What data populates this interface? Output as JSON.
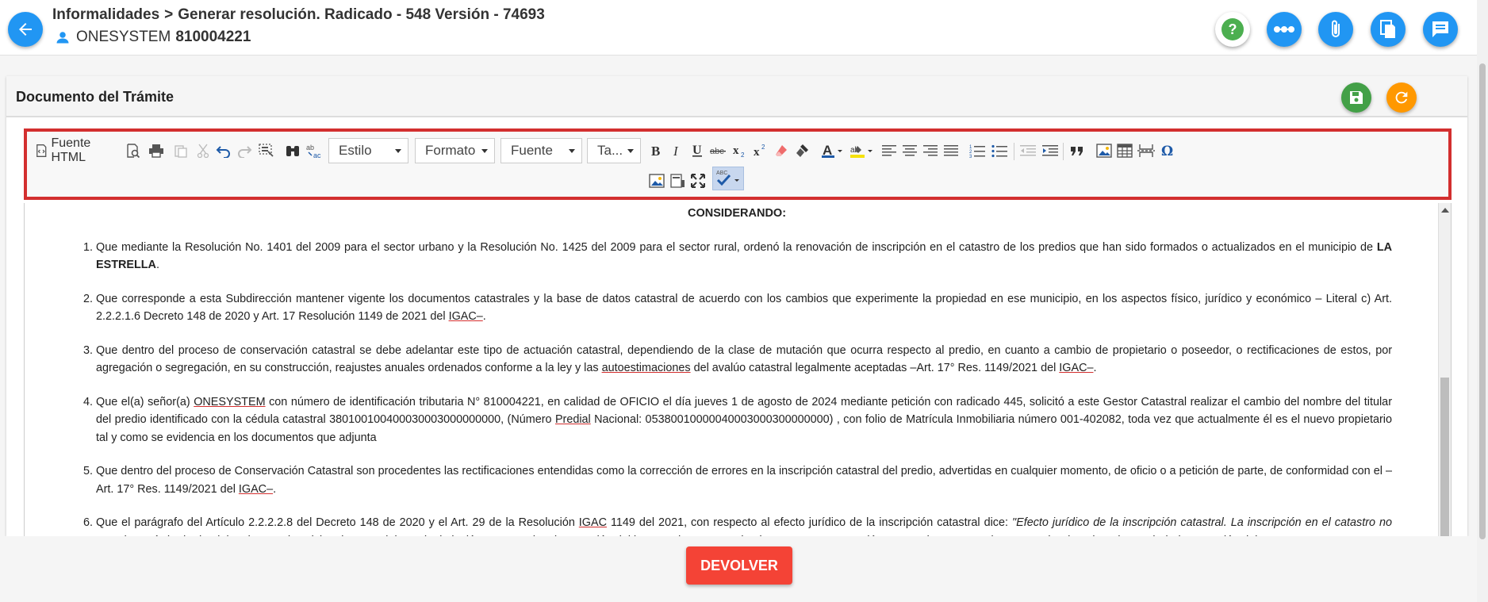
{
  "header": {
    "breadcrumb_root": "Informalidades",
    "breadcrumb_separator": ">",
    "breadcrumb_current": "Generar resolución. Radicado - 548 Versión - 74693",
    "user_name": "ONESYSTEM",
    "user_id": "810004221",
    "action_icons": [
      "help-icon",
      "more-horizontal-icon",
      "attachment-icon",
      "copy-document-icon",
      "comment-icon"
    ]
  },
  "card": {
    "title": "Documento del Trámite",
    "save_icon": "save-icon",
    "reload_icon": "refresh-icon"
  },
  "toolbar": {
    "source_label": "Fuente HTML",
    "style_combo": "Estilo",
    "format_combo": "Formato",
    "font_combo": "Fuente",
    "size_combo": "Ta..."
  },
  "document": {
    "heading": "CONSIDERANDO:",
    "items": [
      {
        "p1": "Que mediante la Resolución No. 1401 del 2009 para el sector urbano y la Resolución No. 1425 del 2009 para el sector rural, ordenó la renovación de inscripción en el catastro de los predios que han sido formados o actualizados en el municipio de ",
        "bold": "LA ESTRELLA",
        "p2": "."
      },
      {
        "p1": "Que corresponde a esta Subdirección mantener vigente los documentos catastrales y la base de datos catastral de acuerdo con los cambios que experimente la propiedad en ese municipio, en los aspectos físico, jurídico y económico – Literal c) Art. 2.2.2.1.6 Decreto 148 de 2020 y Art. 17 Resolución 1149 de 2021 del ",
        "u1": "IGAC–",
        "p2": "."
      },
      {
        "p1": "Que dentro del proceso de conservación catastral se debe adelantar este tipo de actuación catastral, dependiendo de la clase de mutación que ocurra respecto al predio, en cuanto a cambio de propietario o poseedor, o rectificaciones de estos, por agregación o segregación, en su construcción, reajustes anuales ordenados conforme a la ley y las ",
        "u1": "autoestimaciones",
        "p2": " del avalúo catastral legalmente aceptadas –Art. 17° Res. 1149/2021 del ",
        "u2": "IGAC–",
        "p3": "."
      },
      {
        "p1": "Que el(a) señor(a) ",
        "u1": "ONESYSTEM",
        "p2": " con número de identificación tributaria N° 810004221, en calidad de OFICIO el día jueves 1 de agosto de 2024 mediante petición con radicado 445, solicitó a este Gestor Catastral realizar el cambio del nombre del titular del predio identificado con la cédula catastral 380100100400030003000000000, (Número ",
        "u2": "Predial",
        "p3": " Nacional: 05380010000040003000300000000) , con folio de Matrícula Inmobiliaria número 001-402082, toda vez que actualmente él es el nuevo propietario tal y como se evidencia en los documentos que adjunta"
      },
      {
        "p1": "Que dentro del proceso de Conservación Catastral son procedentes las rectificaciones entendidas como la corrección de errores en la inscripción catastral del predio, advertidas en cualquier momento, de oficio o a petición de parte, de conformidad con el –Art. 17° Res. 1149/2021 del ",
        "u1": "IGAC–",
        "p2": "."
      },
      {
        "p1": "Que el parágrafo del Artículo 2.2.2.2.8 del Decreto 148 de 2020 y el Art. 29 de la Resolución ",
        "u1": "IGAC",
        "p2": " 1149 del 2021, con respecto al efecto jurídico de la inscripción catastral dice: ",
        "em": "\"Efecto jurídico de la inscripción catastral. La inscripción en el catastro no constituye título de dominio, ni sanea los vicios de que adolezca la titulación presentada o la posesión del interesado, y no puede alegarse como excepción contra el que pretenda tener mejor derecho a la propiedad o posesión del"
      }
    ]
  },
  "footer": {
    "return_button": "DEVOLVER"
  },
  "colors": {
    "primary": "#2196f3",
    "save": "#43a047",
    "reload": "#ff9800",
    "danger": "#f44336",
    "highlight_border": "#d32f2f"
  }
}
